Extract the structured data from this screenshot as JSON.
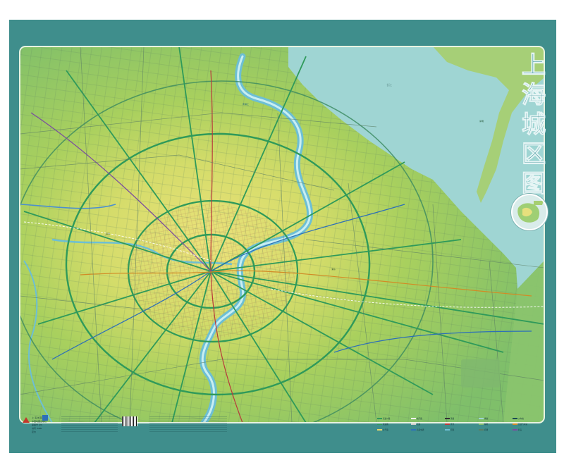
{
  "title": "上海城区图",
  "title_chars": [
    "上",
    "海",
    "城",
    "区",
    "图"
  ],
  "colors": {
    "frame": "#3f8e8c",
    "land_outer": "#8ec46a",
    "land_mid": "#b5d45f",
    "land_core": "#e2e27a",
    "water": "#9fd5d3",
    "river": "#6dbfd4",
    "expressway": "#2f9a5a",
    "road": "#3f6f6a"
  },
  "publisher": {
    "line1": "上 海 城 区 图",
    "line2": "中国地图出版社",
    "line3": "审图号 沪S",
    "line4": "书号 ISBN",
    "line5": "定价"
  },
  "legend_items": [
    "高速公路",
    "快速路",
    "主干路",
    "次干路",
    "支路",
    "轨道交通",
    "铁路",
    "区界",
    "河流",
    "湖泊",
    "绿地",
    "机场",
    "火车站",
    "长途汽车站",
    "码头"
  ],
  "map_labels": [
    "长江",
    "黄浦江",
    "崇明",
    "浦东",
    "浦西"
  ]
}
